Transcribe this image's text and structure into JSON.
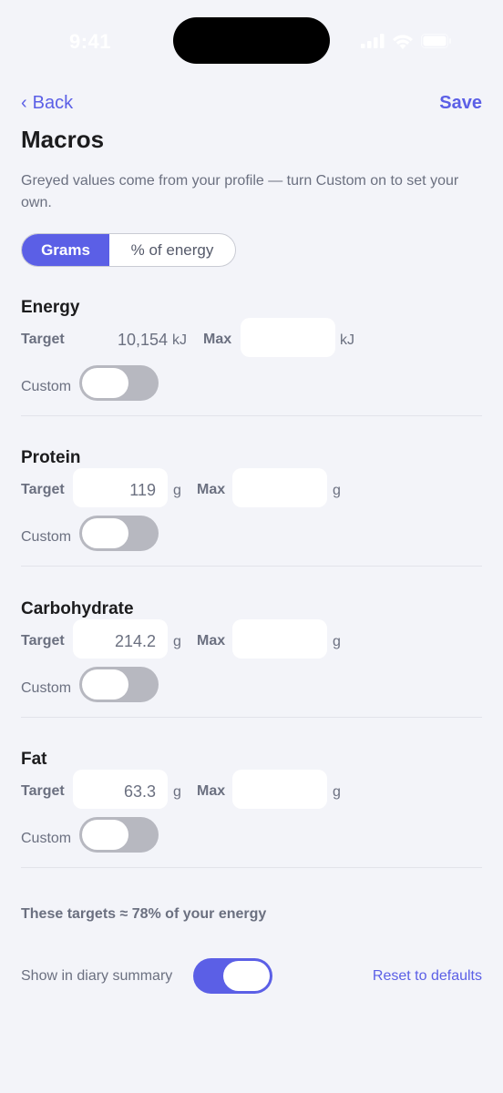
{
  "status_bar": {
    "time": "9:41"
  },
  "nav": {
    "back_label": "Back",
    "back_icon": "chevron-left-icon",
    "save_label": "Save"
  },
  "title": "Macros",
  "subtitle": "Greyed values come from your profile — turn Custom on to set your own.",
  "unit_toggle": {
    "options": [
      "Grams",
      "% of energy"
    ],
    "selected": "Grams"
  },
  "labels": {
    "target": "Target",
    "max": "Max",
    "custom": "Custom"
  },
  "macros": [
    {
      "name": "Energy",
      "target": "10,154",
      "unit": "kJ",
      "max": "",
      "custom": false
    },
    {
      "name": "Protein",
      "target": "119",
      "unit": "g",
      "max": "",
      "custom": false
    },
    {
      "name": "Carbohydrate",
      "target": "214.2",
      "unit": "g",
      "max": "",
      "custom": false
    },
    {
      "name": "Fat",
      "target": "63.3",
      "unit": "g",
      "max": "",
      "custom": false
    }
  ],
  "summary": "These targets ≈ 78% of your energy",
  "show_in_diary": {
    "label": "Show in diary summary",
    "on": true
  },
  "reset_label": "Reset to defaults",
  "colors": {
    "accent": "#5b5fe6",
    "background": "#f3f4f9",
    "toggle_off": "#b7b8c0",
    "text_secondary": "#6b7080"
  }
}
